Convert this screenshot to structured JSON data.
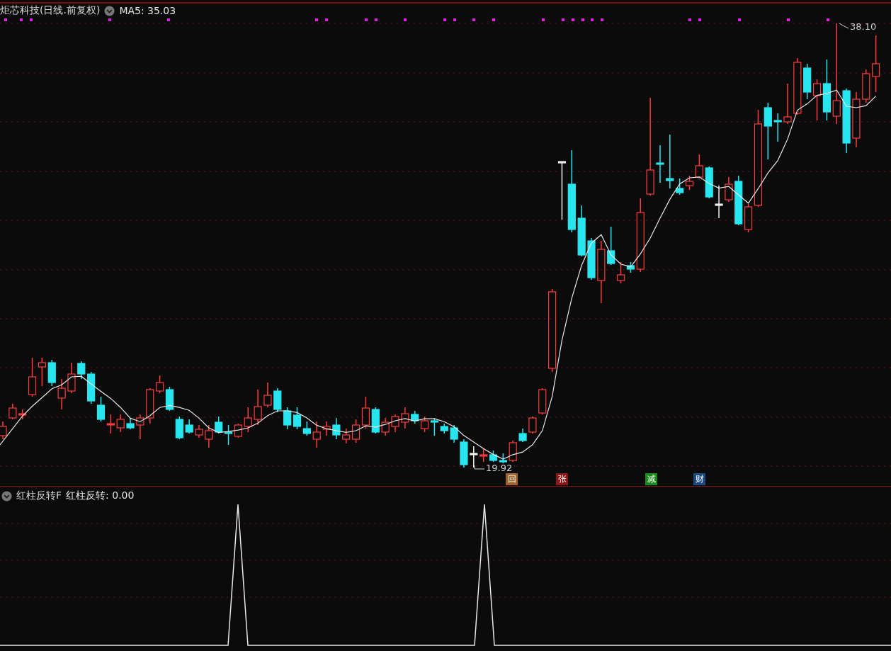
{
  "main_panel": {
    "title": "炬芯科技(日线.前复权)",
    "indicator": "MA5: 35.03",
    "high_label": "38.10",
    "low_label": "19.92",
    "markers": [
      {
        "text": "回",
        "color": "#a0602a"
      },
      {
        "text": "张",
        "color": "#8b1414"
      },
      {
        "text": "减",
        "color": "#1a8a1a"
      },
      {
        "text": "财",
        "color": "#1a4a80"
      }
    ]
  },
  "sub_panel": {
    "title": "红柱反转F",
    "indicator": "红柱反转: 0.00"
  }
}
